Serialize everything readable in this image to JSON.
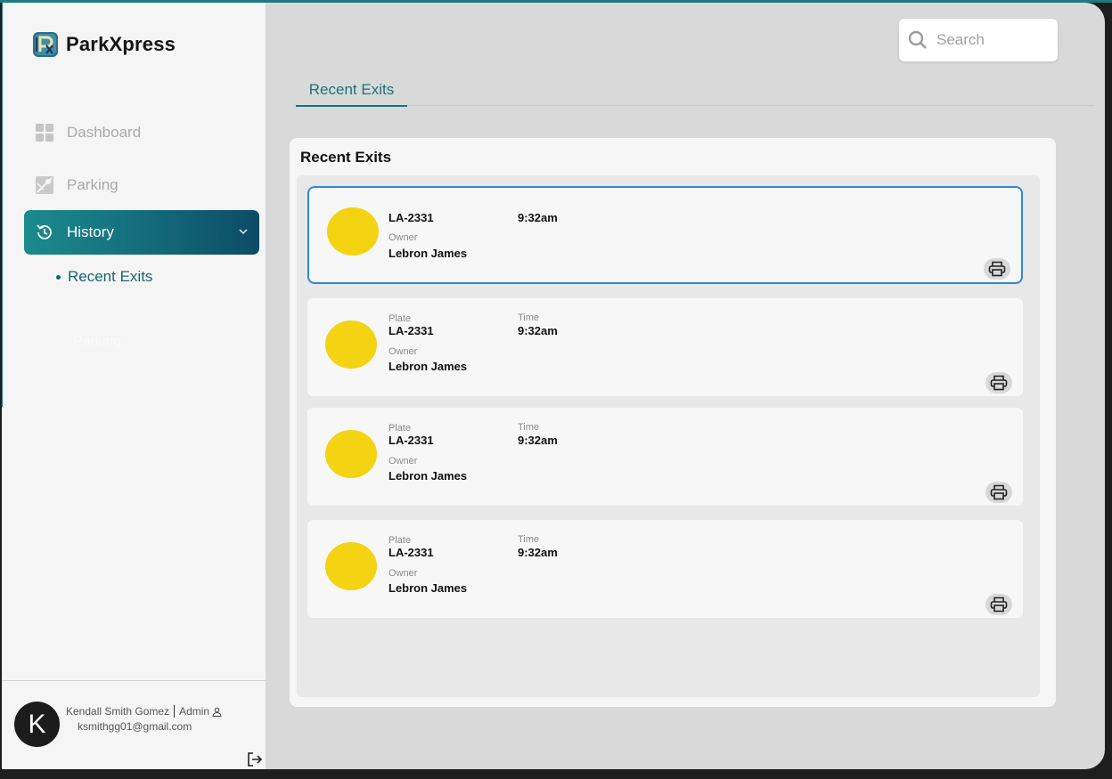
{
  "app": {
    "name": "ParkXpress"
  },
  "sidebar": {
    "items": [
      {
        "label": "Dashboard",
        "icon": "grid-icon",
        "active": false
      },
      {
        "label": "Parking",
        "icon": "map-icon",
        "active": false
      },
      {
        "label": "History",
        "icon": "history-icon",
        "active": true
      }
    ],
    "sub_items": [
      {
        "label": "Recent Exits"
      }
    ],
    "ghost_label": "Parking"
  },
  "user": {
    "initial": "K",
    "name": "Kendall Smith Gomez",
    "role": "Admin",
    "email": "ksmithgg01@gmail.com"
  },
  "search": {
    "placeholder": "Search"
  },
  "tabs": [
    {
      "label": "Recent Exits",
      "active": true
    }
  ],
  "panel": {
    "title": "Recent Exits",
    "cards": [
      {
        "plate_label": "",
        "plate": "LA-2331",
        "time_label": "",
        "time": "9:32am",
        "owner_label": "Owner",
        "owner": "Lebron James",
        "selected": true
      },
      {
        "plate_label": "Plate",
        "plate": "LA-2331",
        "time_label": "Time",
        "time": "9:32am",
        "owner_label": "Owner",
        "owner": "Lebron James",
        "selected": false
      },
      {
        "plate_label": "Plate",
        "plate": "LA-2331",
        "time_label": "Time",
        "time": "9:32am",
        "owner_label": "Owner",
        "owner": "Lebron James",
        "selected": false
      },
      {
        "plate_label": "Plate",
        "plate": "LA-2331",
        "time_label": "Time",
        "time": "9:32am",
        "owner_label": "Owner",
        "owner": "Lebron James",
        "selected": false
      }
    ]
  },
  "colors": {
    "accent": "#19747a",
    "active_gradient_start": "#1b8b8d",
    "active_gradient_end": "#0c4b66",
    "selected_border": "#2e88d2",
    "vehicle_circle": "#f4d313"
  }
}
